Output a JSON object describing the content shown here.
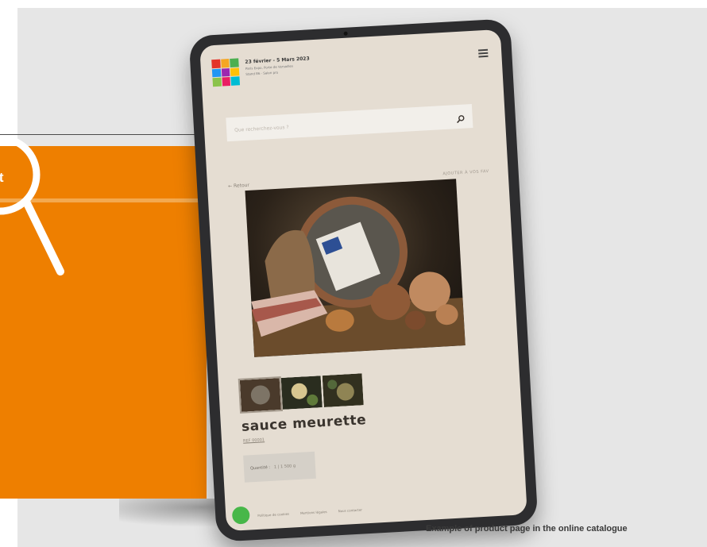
{
  "left_panel": {
    "text_fragment": "ext",
    "magnifier_icon": "magnifier-icon",
    "colors": {
      "orange": "#ee7f00",
      "band": "#f3a94f",
      "divider": "#4b4b4b"
    }
  },
  "tablet": {
    "header": {
      "event_date": "23 février - 5 Mars 2023",
      "event_lines": [
        "Paris Expo, Porte de Versailles",
        "Stand B6 · Salon pro"
      ],
      "menu_icon": "hamburger-menu-icon",
      "logo_colors": [
        "#e4342a",
        "#f5a623",
        "#4caf50",
        "#2196f3",
        "#9c27b0",
        "#ffc107",
        "#8bc34a",
        "#e91e63",
        "#00bcd4"
      ]
    },
    "search": {
      "placeholder": "Que recherchez-vous ?",
      "icon": "search-icon"
    },
    "back_link": "← Retour",
    "add_link": "AJOUTER À VOS FAV",
    "product": {
      "name": "sauce meurette",
      "reference": "REF 00001",
      "quantity_label": "Quantité :",
      "quantity_value": "1 | 1 500 g"
    },
    "bottom_links": [
      "Politique de cookies",
      "Mentions légales",
      "Nous contacter"
    ],
    "chat_icon": "chat-icon"
  },
  "caption": "Example of product page in the online catalogue"
}
